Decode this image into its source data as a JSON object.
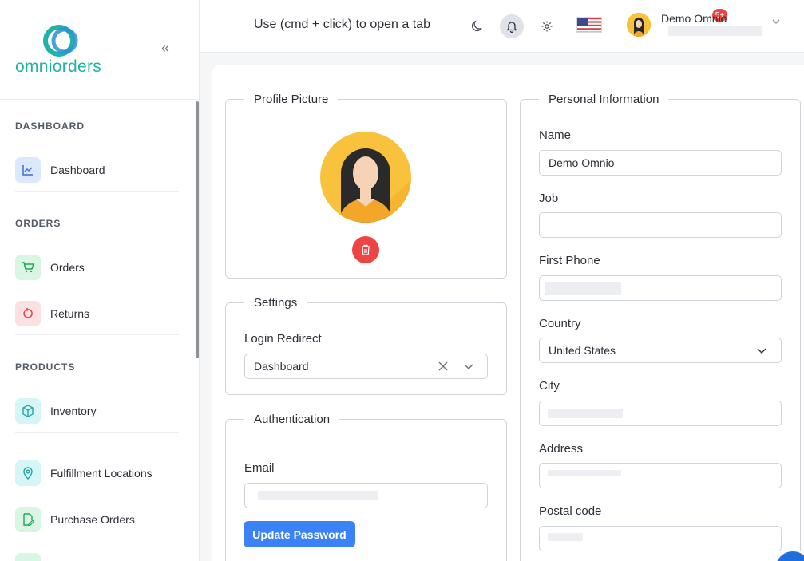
{
  "brand": {
    "name": "omniorders"
  },
  "sidebar": {
    "sections": [
      {
        "title": "DASHBOARD"
      },
      {
        "title": "ORDERS"
      },
      {
        "title": "PRODUCTS"
      }
    ],
    "items": [
      {
        "label": "Dashboard",
        "icon": "chart-line-icon",
        "color": "#dce8ff"
      },
      {
        "label": "Orders",
        "icon": "cart-icon",
        "color": "#d9f5e3"
      },
      {
        "label": "Returns",
        "icon": "return-icon",
        "color": "#fde1e1"
      },
      {
        "label": "Inventory",
        "icon": "box-icon",
        "color": "#d6f5f5"
      },
      {
        "label": "Fulfillment Locations",
        "icon": "location-pin-icon",
        "color": "#d6f5f5"
      },
      {
        "label": "Purchase Orders",
        "icon": "document-edit-icon",
        "color": "#d9f5e3"
      }
    ]
  },
  "header": {
    "hint": "Use (cmd + click) to open a tab",
    "notification_badge": "5+",
    "user_name": "Demo Omnio"
  },
  "profile": {
    "legend": "Profile Picture"
  },
  "settings": {
    "legend": "Settings",
    "login_redirect_label": "Login Redirect",
    "login_redirect_value": "Dashboard"
  },
  "auth": {
    "legend": "Authentication",
    "email_label": "Email",
    "update_password_button": "Update Password"
  },
  "personal": {
    "legend": "Personal Information",
    "name_label": "Name",
    "name_value": "Demo Omnio",
    "job_label": "Job",
    "job_value": "",
    "first_phone_label": "First Phone",
    "country_label": "Country",
    "country_value": "United States",
    "city_label": "City",
    "address_label": "Address",
    "postal_code_label": "Postal code"
  },
  "colors": {
    "accent": "#3b82f6",
    "brand": "#1fb3a6",
    "danger": "#ef4444"
  }
}
